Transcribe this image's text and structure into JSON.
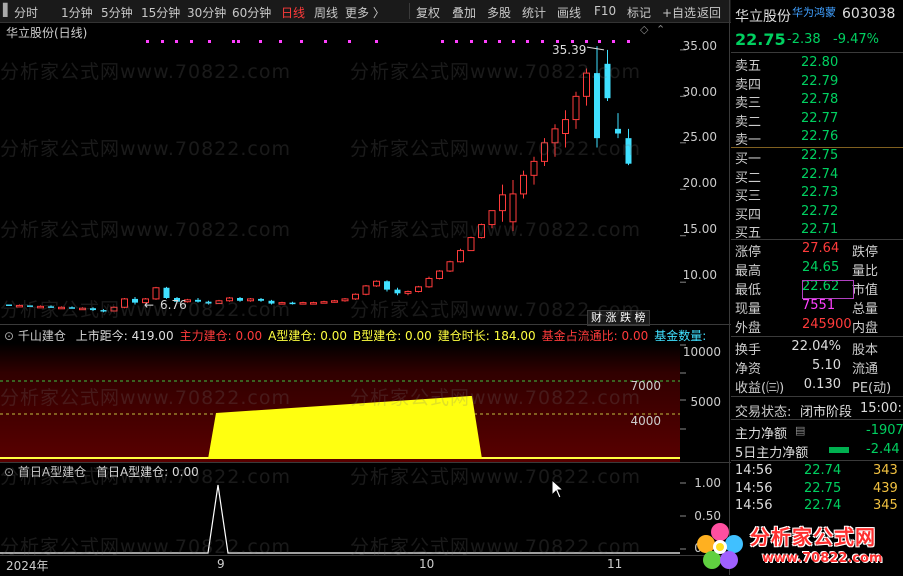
{
  "toolbar": {
    "left_items": [
      "分时",
      "1分钟",
      "5分钟",
      "15分钟",
      "30分钟",
      "60分钟",
      "日线",
      "周线",
      "更多 〉"
    ],
    "active_item": "日线",
    "right_items": [
      "复权",
      "叠加",
      "多股",
      "统计",
      "画线",
      "F10",
      "标记",
      "+自选",
      "返回"
    ]
  },
  "main_chart": {
    "title": "华立股份(日线)",
    "high_label": "35.39",
    "low_label": "6.76",
    "axis": [
      "35.00",
      "30.00",
      "25.00",
      "20.00",
      "15.00",
      "10.00"
    ],
    "badge_text": "财 涨 跌 榜"
  },
  "chart_data": {
    "type": "candlestick",
    "ylim": [
      5.5,
      38
    ],
    "axis_ticks": [
      35,
      30,
      25,
      20,
      15,
      10
    ],
    "x_ticks": [
      "2024年",
      "9",
      "10",
      "11"
    ],
    "candles": [
      [
        7.6,
        7.6,
        7.5,
        7.5
      ],
      [
        7.5,
        7.6,
        7.4,
        7.5
      ],
      [
        7.5,
        7.5,
        7.4,
        7.4
      ],
      [
        7.4,
        7.5,
        7.3,
        7.4
      ],
      [
        7.4,
        7.5,
        7.3,
        7.3
      ],
      [
        7.3,
        7.4,
        7.2,
        7.3
      ],
      [
        7.3,
        7.4,
        7.2,
        7.2
      ],
      [
        7.2,
        7.3,
        7.1,
        7.2
      ],
      [
        7.2,
        7.3,
        6.9,
        7.0
      ],
      [
        7.0,
        7.1,
        6.76,
        6.9
      ],
      [
        6.9,
        7.4,
        6.9,
        7.3
      ],
      [
        7.3,
        8.3,
        7.2,
        8.2
      ],
      [
        8.2,
        8.4,
        7.6,
        7.8
      ],
      [
        7.8,
        8.3,
        7.7,
        8.2
      ],
      [
        8.2,
        9.5,
        8.1,
        9.4
      ],
      [
        9.4,
        9.5,
        8.2,
        8.3
      ],
      [
        8.3,
        8.4,
        7.8,
        7.9
      ],
      [
        7.9,
        8.2,
        7.8,
        8.1
      ],
      [
        8.1,
        8.3,
        7.8,
        7.9
      ],
      [
        7.9,
        8.0,
        7.6,
        7.7
      ],
      [
        7.7,
        8.1,
        7.7,
        8.0
      ],
      [
        8.0,
        8.4,
        7.9,
        8.3
      ],
      [
        8.3,
        8.4,
        7.9,
        8.0
      ],
      [
        8.0,
        8.3,
        7.9,
        8.2
      ],
      [
        8.2,
        8.3,
        7.9,
        8.0
      ],
      [
        8.0,
        8.1,
        7.6,
        7.7
      ],
      [
        7.7,
        7.9,
        7.6,
        7.8
      ],
      [
        7.8,
        7.9,
        7.6,
        7.7
      ],
      [
        7.7,
        7.9,
        7.6,
        7.8
      ],
      [
        7.8,
        7.9,
        7.7,
        7.8
      ],
      [
        7.8,
        8.0,
        7.7,
        7.9
      ],
      [
        7.9,
        8.1,
        7.8,
        8.0
      ],
      [
        8.0,
        8.3,
        7.9,
        8.2
      ],
      [
        8.2,
        8.8,
        8.1,
        8.7
      ],
      [
        8.7,
        9.7,
        8.6,
        9.6
      ],
      [
        9.6,
        10.2,
        9.5,
        10.1
      ],
      [
        10.1,
        10.2,
        9.0,
        9.2
      ],
      [
        9.2,
        9.4,
        8.6,
        8.8
      ],
      [
        8.8,
        9.1,
        8.6,
        9.0
      ],
      [
        9.0,
        9.6,
        8.9,
        9.5
      ],
      [
        9.5,
        10.6,
        9.4,
        10.4
      ],
      [
        10.4,
        11.3,
        10.3,
        11.2
      ],
      [
        11.2,
        12.3,
        11.1,
        12.2
      ],
      [
        12.2,
        13.6,
        12.1,
        13.4
      ],
      [
        13.4,
        14.9,
        13.4,
        14.8
      ],
      [
        14.8,
        16.3,
        14.7,
        16.2
      ],
      [
        16.2,
        17.7,
        15.8,
        17.7
      ],
      [
        17.7,
        20.5,
        16.5,
        19.4
      ],
      [
        16.5,
        21.0,
        15.5,
        19.5
      ],
      [
        19.5,
        22.0,
        19.0,
        21.5
      ],
      [
        21.5,
        23.5,
        20.5,
        23.0
      ],
      [
        23.0,
        25.5,
        22.5,
        25.0
      ],
      [
        25.0,
        27.0,
        23.5,
        26.5
      ],
      [
        26.0,
        28.5,
        24.5,
        27.5
      ],
      [
        27.5,
        30.5,
        26.5,
        30.0
      ],
      [
        30.0,
        33.0,
        29.0,
        32.5
      ],
      [
        32.5,
        35.39,
        24.5,
        25.5
      ],
      [
        33.5,
        35.0,
        29.5,
        29.8
      ],
      [
        26.5,
        28.2,
        25.5,
        26.0
      ],
      [
        25.5,
        26.5,
        22.6,
        22.75
      ]
    ]
  },
  "panel1": {
    "title": "千山建仓",
    "items": [
      {
        "label": "上市距今:",
        "value": "419.00",
        "color": "#dddddd"
      },
      {
        "label": "主力建仓:",
        "value": "0.00",
        "color": "#ff3b3b"
      },
      {
        "label": "A型建仓:",
        "value": "0.00",
        "color": "#ffff40"
      },
      {
        "label": "B型建仓:",
        "value": "0.00",
        "color": "#ffff40"
      },
      {
        "label": "建仓时长:",
        "value": "184.00",
        "color": "#ffff40"
      },
      {
        "label": "基金占流通比:",
        "value": "0.00",
        "color": "#ff3b3b"
      },
      {
        "label": "基金数量:",
        "value": "",
        "color": "#40e0ff"
      }
    ],
    "axis": [
      "10000",
      "7000",
      "5000",
      "4000"
    ]
  },
  "panel2": {
    "title": "首日A型建仓",
    "items": [
      {
        "label": "首日A型建仓:",
        "value": "0.00",
        "color": "#dddddd"
      }
    ],
    "axis": [
      "1.00",
      "0.50",
      "0.00"
    ]
  },
  "xaxis": {
    "labels": [
      "2024年",
      "9",
      "10",
      "11"
    ]
  },
  "watermark": "分析家公式网www.70822.com",
  "brand": {
    "name": "分析家公式网",
    "url": "www.70822.com"
  },
  "stock": {
    "name": "华立股份",
    "tag": "华为鸿蒙",
    "code": "603038",
    "price": "22.75",
    "change": "-2.38",
    "pct": "-9.47%"
  },
  "asks": [
    {
      "label": "卖五",
      "price": "22.80",
      "vol": ""
    },
    {
      "label": "卖四",
      "price": "22.79",
      "vol": ""
    },
    {
      "label": "卖三",
      "price": "22.78",
      "vol": ""
    },
    {
      "label": "卖二",
      "price": "22.77",
      "vol": ""
    },
    {
      "label": "卖一",
      "price": "22.76",
      "vol": ""
    }
  ],
  "bids": [
    {
      "label": "买一",
      "price": "22.75",
      "vol": ""
    },
    {
      "label": "买二",
      "price": "22.74",
      "vol": ""
    },
    {
      "label": "买三",
      "price": "22.73",
      "vol": ""
    },
    {
      "label": "买四",
      "price": "22.72",
      "vol": ""
    },
    {
      "label": "买五",
      "price": "22.71",
      "vol": ""
    }
  ],
  "stats1": [
    {
      "l1": "涨停",
      "v1": "27.64",
      "c1": "#ff3b3b",
      "l2": "跌停"
    },
    {
      "l1": "最高",
      "v1": "24.65",
      "c1": "#00d060",
      "l2": "量比"
    },
    {
      "l1": "最低",
      "v1": "22.62",
      "c1": "#00d060",
      "l2": "市值"
    },
    {
      "l1": "现量",
      "v1": "7551",
      "c1": "#ff40ff",
      "l2": "总量"
    },
    {
      "l1": "外盘",
      "v1": "245900",
      "c1": "#ff3b3b",
      "l2": "内盘"
    }
  ],
  "stats2": [
    {
      "l1": "换手",
      "v1": "22.04%",
      "l2": "股本"
    },
    {
      "l1": "净资",
      "v1": "5.10",
      "l2": "流通"
    },
    {
      "l1": "收益(㈢)",
      "v1": "0.130",
      "l2": "PE(动)"
    }
  ],
  "trade_status": {
    "label": "交易状态:",
    "value": "闭市阶段",
    "time": "15:00:"
  },
  "flows": [
    {
      "label": "主力净额",
      "value": "-1907"
    },
    {
      "label": "5日主力净额",
      "value": "-2.44"
    }
  ],
  "ticks": [
    {
      "time": "14:56",
      "price": "22.74",
      "vol": "343"
    },
    {
      "time": "14:56",
      "price": "22.75",
      "vol": "439"
    },
    {
      "time": "14:56",
      "price": "22.74",
      "vol": "345"
    }
  ]
}
